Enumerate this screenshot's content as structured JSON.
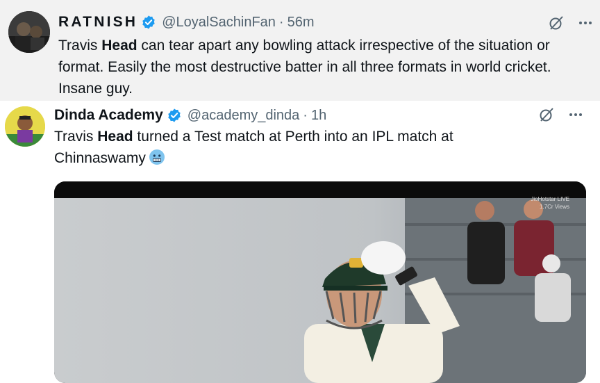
{
  "tweets": [
    {
      "display_name": "RATNISH",
      "handle": "@LoyalSachinFan",
      "separator": "·",
      "time": "56m",
      "text": {
        "t1": "Travis ",
        "highlight": "Head",
        "t2": " can tear apart any bowling attack irrespective of the situation or format. Easily the most destructive batter in all three formats in world cricket. Insane guy."
      },
      "icons": {
        "verified": "verified-badge-icon",
        "grok": "grok-slash-icon",
        "more": "more-dots-icon"
      }
    },
    {
      "display_name": "Dinda Academy",
      "handle": "@academy_dinda",
      "separator": "·",
      "time": "1h",
      "text": {
        "t1": "Travis ",
        "highlight": "Head",
        "t2": " turned a Test match at Perth into an IPL match at Chinnaswamy"
      },
      "emoji": "cold-face-emoji",
      "media": {
        "type": "video-still",
        "watermark": "JioHotstar",
        "live_badge": "LIVE",
        "views": "1.7Cr Views"
      },
      "icons": {
        "verified": "verified-badge-icon",
        "grok": "grok-slash-icon",
        "more": "more-dots-icon"
      }
    }
  ],
  "colors": {
    "verified_blue": "#1d9bf0",
    "muted_text": "#536471",
    "primary_text": "#0f1419",
    "tweet1_bg": "#f2f2f2"
  }
}
